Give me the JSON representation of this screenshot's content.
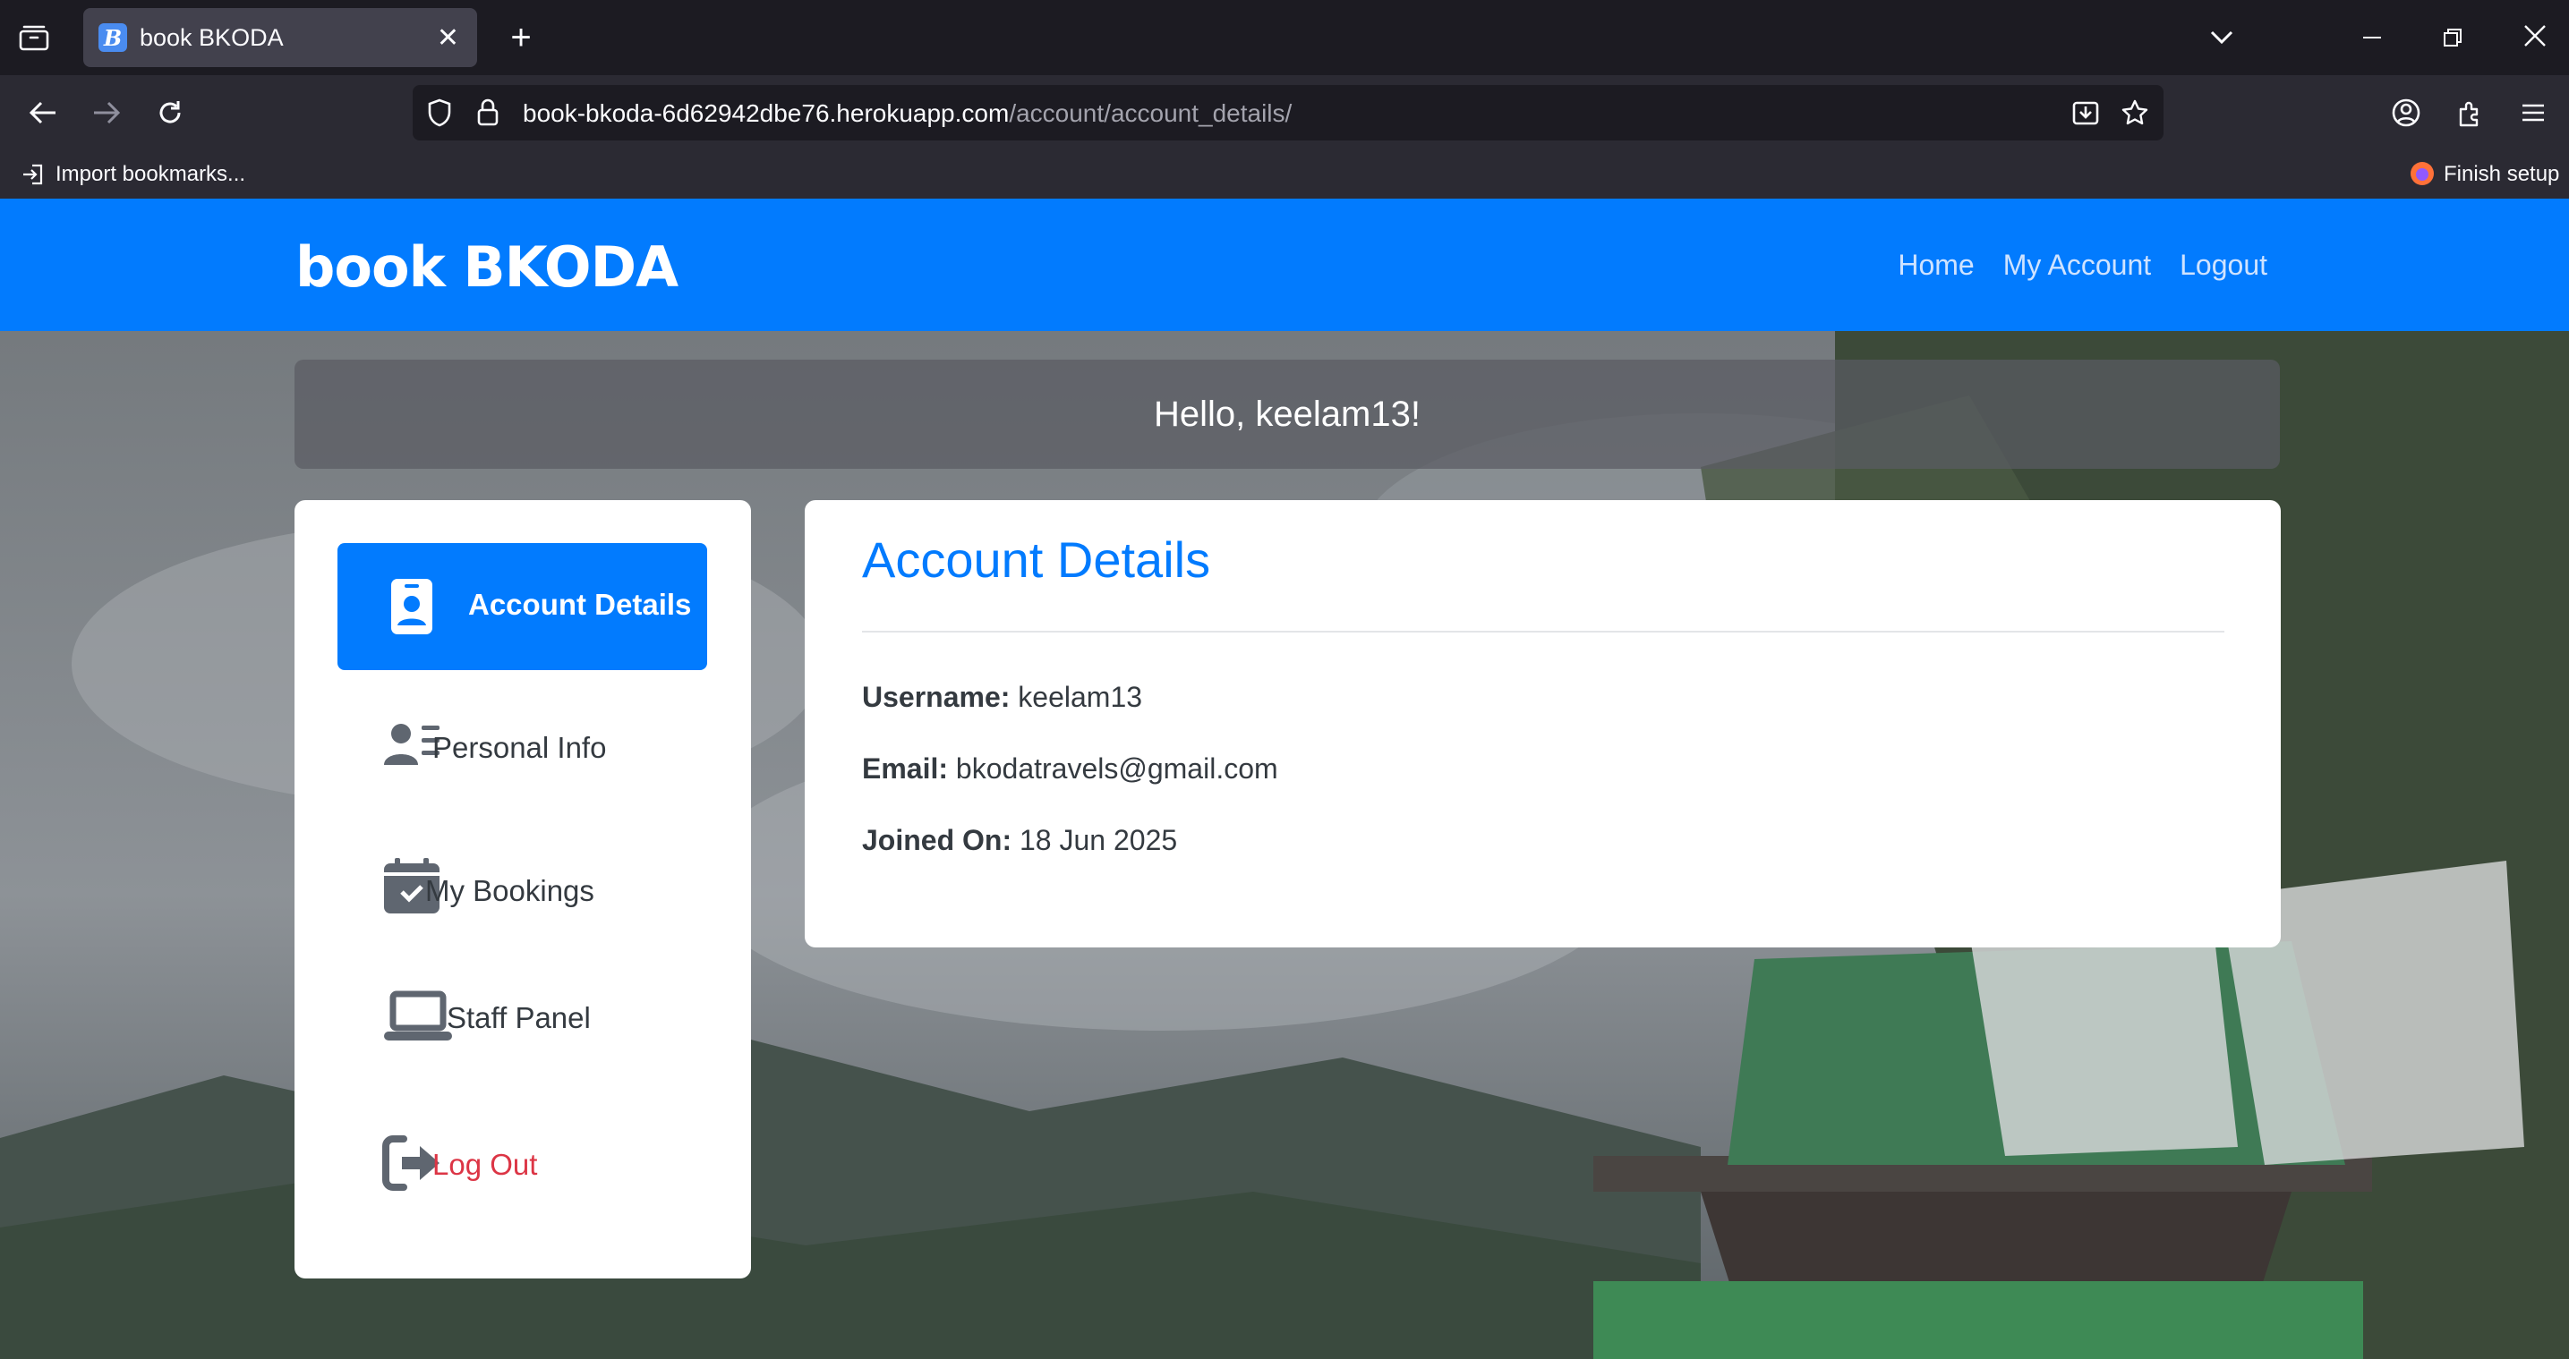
{
  "browser": {
    "tab_title": "book BKODA",
    "tab_favicon_letter": "B",
    "url_host": "book-bkoda-6d62942dbe76.herokuapp.com",
    "url_path": "/account/account_details/",
    "bookmark_import": "Import bookmarks...",
    "finish_setup": "Finish setup"
  },
  "site": {
    "brand": "book BKODA",
    "nav": [
      "Home",
      "My Account",
      "Logout"
    ],
    "greeting_prefix": "Hello, ",
    "greeting_user": "keelam13",
    "greeting_suffix": "!"
  },
  "sidebar": {
    "items": [
      {
        "label": "Account Details",
        "icon": "id-badge-icon",
        "active": true
      },
      {
        "label": "Personal Info",
        "icon": "user-list-icon",
        "active": false
      },
      {
        "label": "My Bookings",
        "icon": "calendar-check-icon",
        "active": false
      },
      {
        "label": "Staff Panel",
        "icon": "laptop-icon",
        "active": false
      },
      {
        "label": "Log Out",
        "icon": "sign-out-icon",
        "active": false
      }
    ]
  },
  "account": {
    "heading": "Account Details",
    "username_label": "Username:",
    "username": "keelam13",
    "email_label": "Email:",
    "email": "bkodatravels@gmail.com",
    "joined_label": "Joined On:",
    "joined": "18 Jun 2025"
  },
  "colors": {
    "accent": "#027bfe",
    "danger": "#dc3545",
    "text": "#343a40"
  }
}
